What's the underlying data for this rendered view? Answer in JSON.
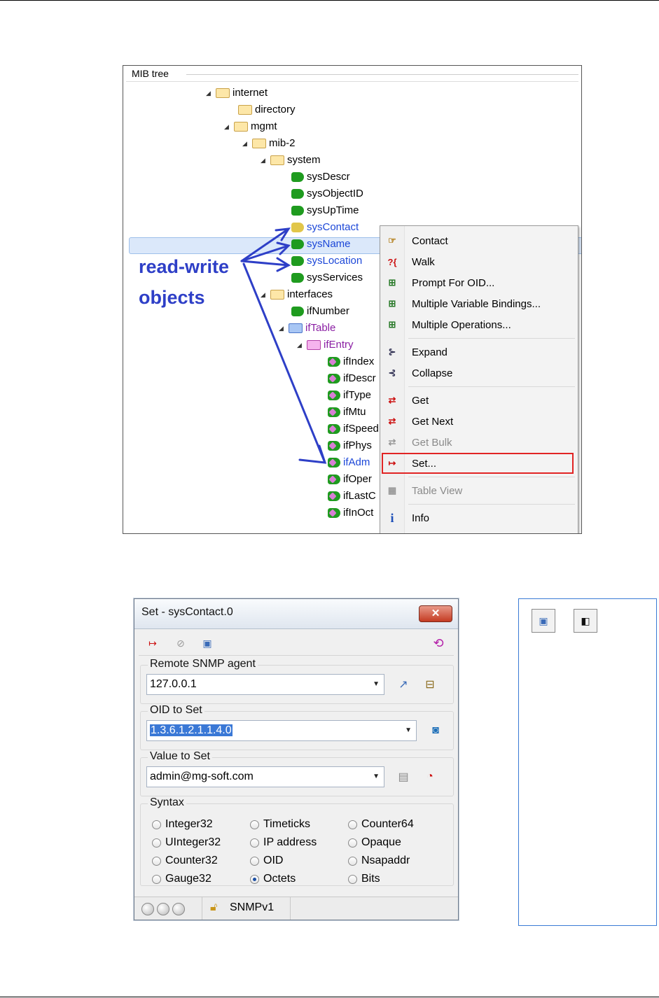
{
  "mib_tree": {
    "title": "MIB tree",
    "nodes": [
      {
        "label": "internet",
        "kind": "folder"
      },
      {
        "label": "directory",
        "kind": "folder"
      },
      {
        "label": "mgmt",
        "kind": "folder"
      },
      {
        "label": "mib-2",
        "kind": "folder"
      },
      {
        "label": "system",
        "kind": "folder"
      },
      {
        "label": "sysDescr",
        "kind": "leaf"
      },
      {
        "label": "sysObjectID",
        "kind": "leaf"
      },
      {
        "label": "sysUpTime",
        "kind": "leaf"
      },
      {
        "label": "sysContact",
        "kind": "leaf-rw"
      },
      {
        "label": "sysName",
        "kind": "leaf-rw"
      },
      {
        "label": "sysLocation",
        "kind": "leaf-rw"
      },
      {
        "label": "sysServices",
        "kind": "leaf"
      },
      {
        "label": "interfaces",
        "kind": "folder"
      },
      {
        "label": "ifNumber",
        "kind": "leaf"
      },
      {
        "label": "ifTable",
        "kind": "table"
      },
      {
        "label": "ifEntry",
        "kind": "entry"
      },
      {
        "label": "ifIndex",
        "kind": "column"
      },
      {
        "label": "ifDescr",
        "kind": "column"
      },
      {
        "label": "ifType",
        "kind": "column"
      },
      {
        "label": "ifMtu",
        "kind": "column"
      },
      {
        "label": "ifSpeed",
        "kind": "column"
      },
      {
        "label": "ifPhys",
        "kind": "column"
      },
      {
        "label": "ifAdm",
        "kind": "column"
      },
      {
        "label": "ifOper",
        "kind": "column"
      },
      {
        "label": "ifLastC",
        "kind": "column"
      },
      {
        "label": "ifInOct",
        "kind": "column"
      }
    ],
    "annotation_line1": "read-write",
    "annotation_line2": "objects"
  },
  "context_menu": {
    "items": [
      {
        "label": "Contact",
        "icon": "contact-icon"
      },
      {
        "label": "Walk",
        "icon": "walk-icon"
      },
      {
        "label": "Prompt For OID...",
        "icon": "prompt-oid-icon"
      },
      {
        "label": "Multiple Variable Bindings...",
        "icon": "multi-varbind-icon"
      },
      {
        "label": "Multiple Operations...",
        "icon": "multi-ops-icon"
      },
      {
        "label": "Expand",
        "icon": "expand-icon"
      },
      {
        "label": "Collapse",
        "icon": "collapse-icon"
      },
      {
        "label": "Get",
        "icon": "get-icon"
      },
      {
        "label": "Get Next",
        "icon": "get-next-icon"
      },
      {
        "label": "Get Bulk",
        "icon": "get-bulk-icon"
      },
      {
        "label": "Set...",
        "icon": "set-icon"
      },
      {
        "label": "Table View",
        "icon": "table-view-icon"
      },
      {
        "label": "Info",
        "icon": "info-icon"
      }
    ]
  },
  "set_dialog": {
    "title": "Set - sysContact.0",
    "close_label": "✕",
    "remote_agent_label": "Remote SNMP agent",
    "remote_agent_value": "127.0.0.1",
    "oid_label": "OID to Set",
    "oid_value": "1.3.6.1.2.1.1.4.0",
    "value_label": "Value to Set",
    "value_value": "admin@mg-soft.com",
    "syntax_label": "Syntax",
    "syntax_options": [
      "Integer32",
      "Timeticks",
      "Counter64",
      "UInteger32",
      "IP address",
      "Opaque",
      "Counter32",
      "OID",
      "Nsapaddr",
      "Gauge32",
      "Octets",
      "Bits"
    ],
    "syntax_selected": "Octets",
    "status_protocol": "SNMPv1"
  },
  "colors": {
    "accent": "#1c47d8",
    "annotation": "#2e3fc7",
    "highlight": "#e12424"
  }
}
